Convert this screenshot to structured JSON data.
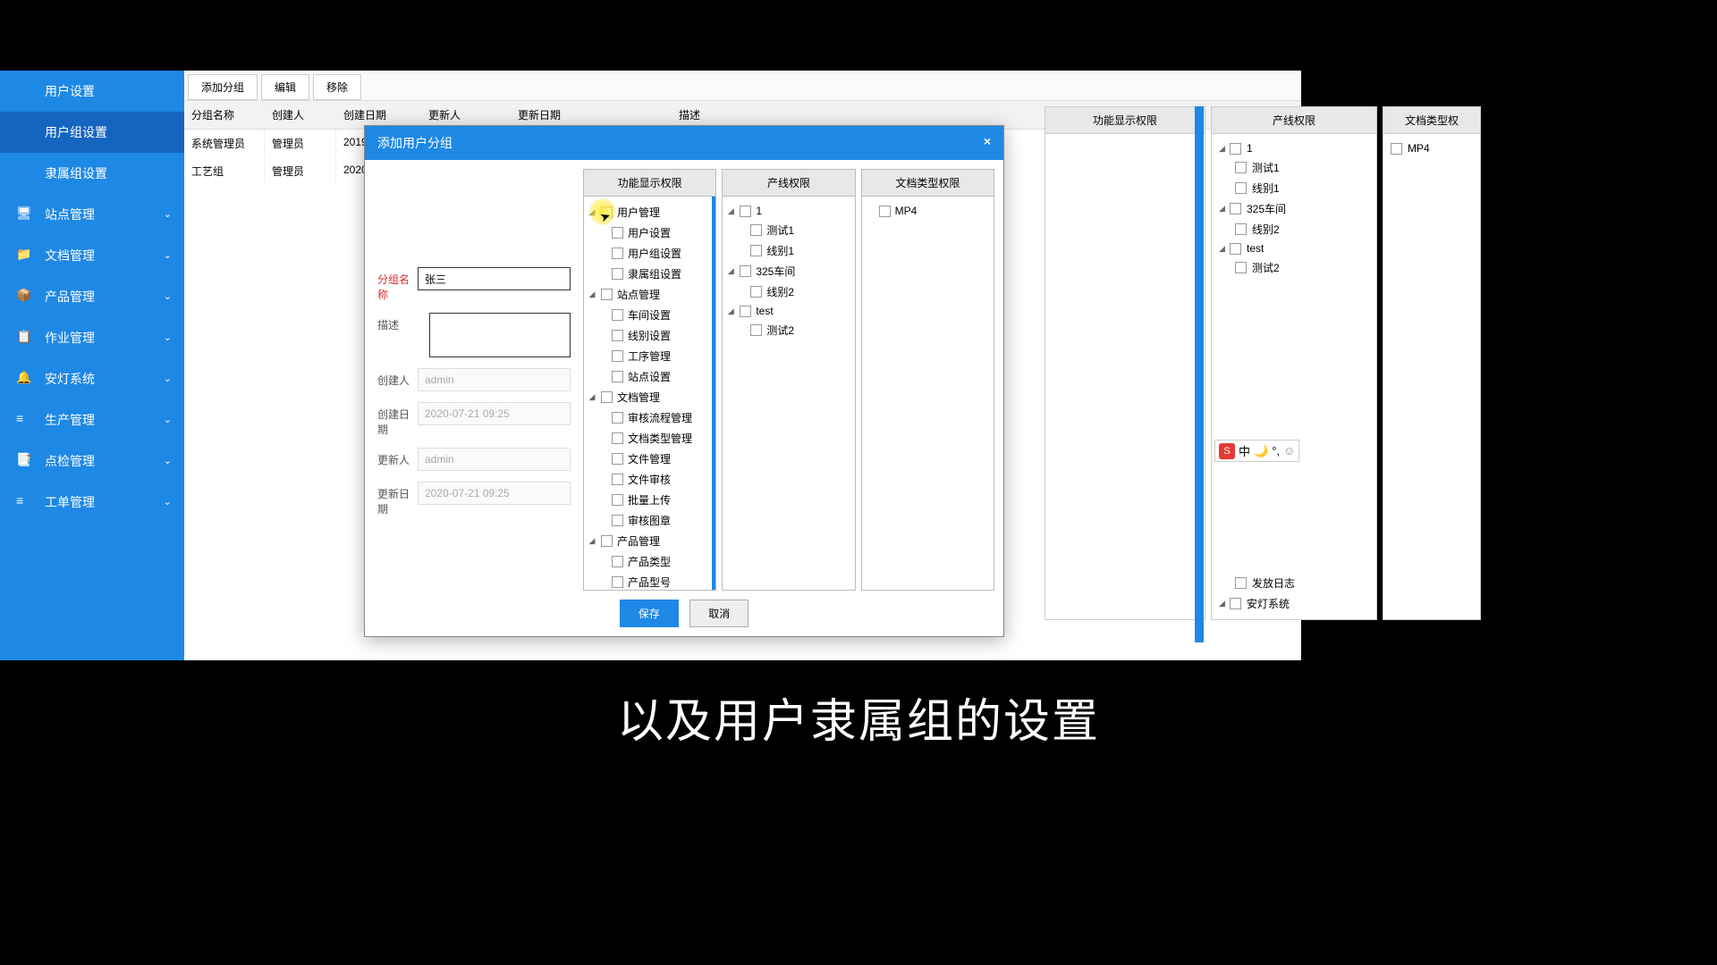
{
  "sidebar": {
    "items": [
      {
        "label": "用户设置",
        "icon": "",
        "expandable": false,
        "active": false
      },
      {
        "label": "用户组设置",
        "icon": "",
        "expandable": false,
        "active": true
      },
      {
        "label": "隶属组设置",
        "icon": "",
        "expandable": false,
        "active": false
      },
      {
        "label": "站点管理",
        "icon": "monitor",
        "expandable": true,
        "active": false
      },
      {
        "label": "文档管理",
        "icon": "folder",
        "expandable": true,
        "active": false
      },
      {
        "label": "产品管理",
        "icon": "cube",
        "expandable": true,
        "active": false
      },
      {
        "label": "作业管理",
        "icon": "tasks",
        "expandable": true,
        "active": false
      },
      {
        "label": "安灯系统",
        "icon": "bell",
        "expandable": true,
        "active": false
      },
      {
        "label": "生产管理",
        "icon": "layers",
        "expandable": true,
        "active": false
      },
      {
        "label": "点检管理",
        "icon": "clipboard",
        "expandable": true,
        "active": false
      },
      {
        "label": "工单管理",
        "icon": "layers",
        "expandable": true,
        "active": false
      }
    ]
  },
  "toolbar": {
    "add": "添加分组",
    "edit": "编辑",
    "remove": "移除"
  },
  "grid": {
    "headers": {
      "name": "分组名称",
      "creator": "创建人",
      "cdate": "创建日期",
      "updater": "更新人",
      "udate": "更新日期",
      "desc": "描述"
    },
    "rows": [
      {
        "name": "系统管理员",
        "creator": "管理员",
        "cdate": "2019-",
        "updater": "",
        "udate": "",
        "desc": ""
      },
      {
        "name": "工艺组",
        "creator": "管理员",
        "cdate": "2020-0",
        "updater": "",
        "udate": "",
        "desc": ""
      }
    ]
  },
  "right_panels": {
    "p1": {
      "title": "功能显示权限"
    },
    "p2": {
      "title": "产线权限",
      "tree": [
        {
          "label": "1",
          "children": [
            {
              "label": "测试1"
            },
            {
              "label": "线别1"
            }
          ]
        },
        {
          "label": "325车间",
          "children": [
            {
              "label": "线别2"
            }
          ]
        },
        {
          "label": "test",
          "children": [
            {
              "label": "测试2"
            }
          ]
        }
      ],
      "extra": [
        {
          "label": "发放日志"
        },
        {
          "label": "安灯系统"
        }
      ]
    },
    "p3": {
      "title": "文档类型权",
      "items": [
        {
          "label": "MP4"
        }
      ]
    }
  },
  "modal": {
    "title": "添加用户分组",
    "close": "×",
    "form": {
      "group_name": {
        "label": "分组名称",
        "value": "张三",
        "required": true
      },
      "desc": {
        "label": "描述",
        "value": ""
      },
      "creator": {
        "label": "创建人",
        "value": "admin"
      },
      "cdate": {
        "label": "创建日期",
        "value": "2020-07-21 09:25"
      },
      "updater": {
        "label": "更新人",
        "value": "admin"
      },
      "udate": {
        "label": "更新日期",
        "value": "2020-07-21 09:25"
      }
    },
    "perm_cols": {
      "func": {
        "title": "功能显示权限",
        "tree": [
          {
            "label": "用户管理",
            "children": [
              {
                "label": "用户设置"
              },
              {
                "label": "用户组设置"
              },
              {
                "label": "隶属组设置"
              }
            ]
          },
          {
            "label": "站点管理",
            "children": [
              {
                "label": "车间设置"
              },
              {
                "label": "线别设置"
              },
              {
                "label": "工序管理"
              },
              {
                "label": "站点设置"
              }
            ]
          },
          {
            "label": "文档管理",
            "children": [
              {
                "label": "审核流程管理"
              },
              {
                "label": "文档类型管理"
              },
              {
                "label": "文件管理"
              },
              {
                "label": "文件审核"
              },
              {
                "label": "批量上传"
              },
              {
                "label": "审核图章"
              }
            ]
          },
          {
            "label": "产品管理",
            "children": [
              {
                "label": "产品类型"
              },
              {
                "label": "产品型号"
              }
            ]
          }
        ]
      },
      "line": {
        "title": "产线权限",
        "tree": [
          {
            "label": "1",
            "children": [
              {
                "label": "测试1"
              },
              {
                "label": "线别1"
              }
            ]
          },
          {
            "label": "325车间",
            "children": [
              {
                "label": "线别2"
              }
            ]
          },
          {
            "label": "test",
            "children": [
              {
                "label": "测试2"
              }
            ]
          }
        ]
      },
      "doc": {
        "title": "文档类型权限",
        "items": [
          {
            "label": "MP4"
          }
        ]
      }
    },
    "buttons": {
      "save": "保存",
      "cancel": "取消"
    }
  },
  "subtitle": "以及用户隶属组的设置",
  "ime": {
    "logo": "S",
    "lang": "中",
    "moon": "🌙",
    "face": "☺"
  }
}
